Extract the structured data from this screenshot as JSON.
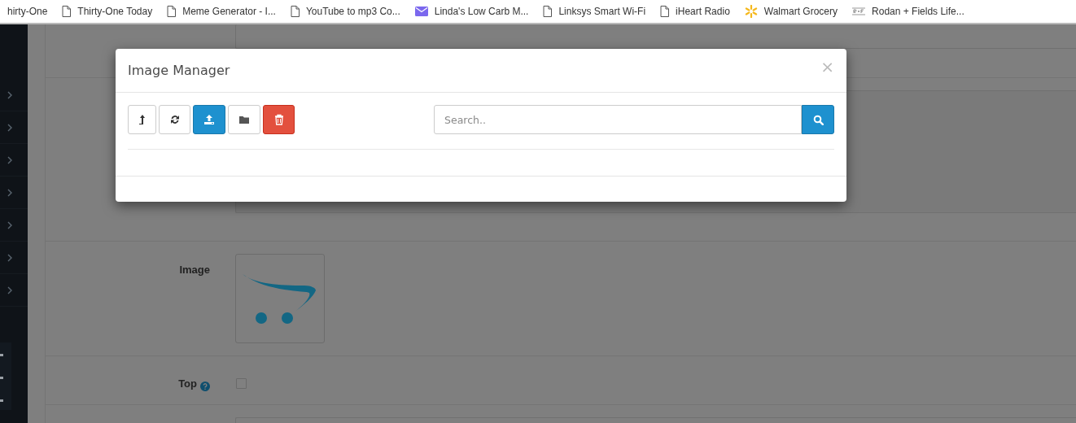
{
  "bookmarks": [
    {
      "label": "hirty-One",
      "kind": "none"
    },
    {
      "label": "Thirty-One Today",
      "kind": "page"
    },
    {
      "label": "Meme Generator - I...",
      "kind": "page"
    },
    {
      "label": "YouTube to mp3 Co...",
      "kind": "page"
    },
    {
      "label": "Linda's Low Carb M...",
      "kind": "mail"
    },
    {
      "label": "Linksys Smart Wi-Fi",
      "kind": "page"
    },
    {
      "label": "iHeart Radio",
      "kind": "page"
    },
    {
      "label": "Walmart Grocery",
      "kind": "spark"
    },
    {
      "label": "Rodan + Fields Life...",
      "kind": "logo"
    }
  ],
  "sidebar": {
    "items": [
      {
        "kind": "chevron"
      },
      {
        "kind": "chevron"
      },
      {
        "kind": "chevron"
      },
      {
        "kind": "chevron"
      },
      {
        "kind": "chevron"
      },
      {
        "kind": "chevron"
      },
      {
        "kind": "chevron"
      }
    ]
  },
  "form": {
    "rows": [
      {
        "kind": "field-top"
      },
      {
        "kind": "textarea"
      },
      {
        "kind": "image",
        "label": "Image"
      },
      {
        "kind": "checkbox",
        "label": "Top",
        "help": true,
        "checked": false
      },
      {
        "kind": "field-bottom"
      }
    ]
  },
  "modal": {
    "title": "Image Manager",
    "close": "×",
    "buttons": [
      {
        "kind": "parent"
      },
      {
        "kind": "refresh"
      },
      {
        "kind": "upload"
      },
      {
        "kind": "folder"
      },
      {
        "kind": "delete"
      }
    ],
    "search": {
      "placeholder": "Search.."
    }
  }
}
